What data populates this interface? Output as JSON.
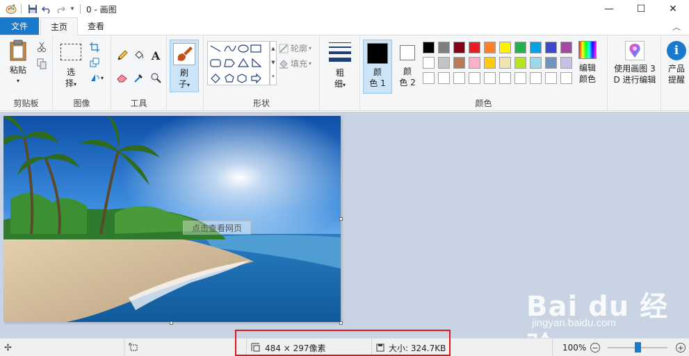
{
  "window": {
    "title": "0 - 画图",
    "minimize_glyph": "—",
    "maximize_glyph": "☐",
    "close_glyph": "✕"
  },
  "tabs": [
    {
      "label": "文件"
    },
    {
      "label": "主页"
    },
    {
      "label": "查看"
    }
  ],
  "ribbon": {
    "clipboard": {
      "group_label": "剪贴板",
      "paste_label": "粘贴"
    },
    "image": {
      "group_label": "图像",
      "select_label_1": "选",
      "select_label_2": "择"
    },
    "tools": {
      "group_label": "工具"
    },
    "brushes": {
      "label_1": "刷",
      "label_2": "子"
    },
    "shapes": {
      "group_label": "形状",
      "outline_label": "轮廓",
      "fill_label": "填充"
    },
    "size": {
      "label_1": "粗",
      "label_2": "细"
    },
    "color1": {
      "label_1": "颜",
      "label_2": "色 1"
    },
    "color2": {
      "label_1": "颜",
      "label_2": "色 2"
    },
    "colors": {
      "group_label": "颜色"
    },
    "edit_colors": {
      "label_1": "编辑",
      "label_2": "颜色"
    },
    "paint3d": {
      "label_1": "使用画图 3",
      "label_2": "D 进行编辑"
    },
    "product": {
      "label_1": "产品",
      "label_2": "提醒"
    }
  },
  "palette": {
    "row1": [
      "#000000",
      "#7f7f7f",
      "#880015",
      "#ed1c24",
      "#ff7f27",
      "#fff200",
      "#22b14c",
      "#00a2e8",
      "#3f48cc",
      "#a349a4"
    ],
    "row2": [
      "#ffffff",
      "#c3c3c3",
      "#b97a57",
      "#ffaec9",
      "#ffc90e",
      "#efe4b0",
      "#b5e61d",
      "#99d9ea",
      "#7092be",
      "#c8bfe7"
    ],
    "row3": [
      "#ffffff",
      "#ffffff",
      "#ffffff",
      "#ffffff",
      "#ffffff",
      "#ffffff",
      "#ffffff",
      "#ffffff",
      "#ffffff",
      "#ffffff"
    ],
    "color1": "#000000",
    "color2": "#ffffff"
  },
  "canvas": {
    "overlay_text": "点击查看网页"
  },
  "watermark": {
    "main": "Bai du 经验",
    "sub": "jingyan.baidu.com"
  },
  "status": {
    "image_size": "484 × 297像素",
    "file_size": "大小: 324.7KB",
    "zoom": "100%",
    "zoom_level": 0.5
  },
  "colors": {
    "accent": "#1979ca",
    "highlight_box": "#e4141b"
  }
}
